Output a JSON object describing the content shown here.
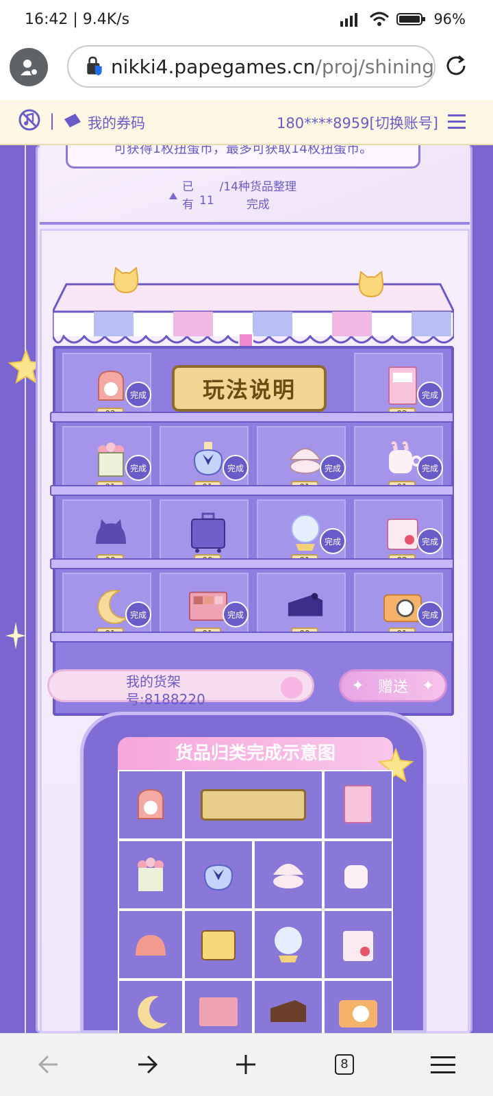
{
  "status": {
    "time_speed": "16:42 | 9.4K/s",
    "battery": "96%"
  },
  "browser": {
    "url_domain": "nikki4.papegames.cn",
    "url_path": "/proj/shining",
    "tab_count": "8"
  },
  "site_header": {
    "separator": "|",
    "coupon_label": "我的券码",
    "account": "180****8959[切换账号]"
  },
  "top_panel": {
    "tip_text": "可获得1枚扭蛋币，最多可获取14枚扭蛋币。",
    "progress_prefix_1": "已",
    "progress_prefix_2": "有",
    "progress_count": "11",
    "progress_suffix_1": "/14种货品整理",
    "progress_suffix_2": "完成"
  },
  "shelf": {
    "instructions_sign": "玩法说明",
    "done_label": "完成",
    "items": [
      {
        "icon": "backpack-icon",
        "count": "02",
        "done": true
      },
      {
        "icon": "photo-album-icon",
        "count": "02",
        "done": true
      },
      {
        "icon": "flower-basket-icon",
        "count": "01",
        "done": true
      },
      {
        "icon": "perfume-bottle-icon",
        "count": "01",
        "done": true
      },
      {
        "icon": "shell-icon",
        "count": "01",
        "done": true
      },
      {
        "icon": "bunny-mug-icon",
        "count": "01",
        "done": true
      },
      {
        "icon": "cat-hat-icon",
        "count": "00",
        "done": false
      },
      {
        "icon": "suitcase-icon",
        "count": "00",
        "done": false
      },
      {
        "icon": "crystal-ball-icon",
        "count": "01",
        "done": true
      },
      {
        "icon": "milk-carton-icon",
        "count": "02",
        "done": true
      },
      {
        "icon": "moon-pillow-icon",
        "count": "01",
        "done": true
      },
      {
        "icon": "makeup-palette-icon",
        "count": "01",
        "done": true
      },
      {
        "icon": "cake-icon",
        "count": "00",
        "done": false
      },
      {
        "icon": "camera-icon",
        "count": "01",
        "done": true
      }
    ]
  },
  "my_shelf": {
    "label_line1": "我的货架",
    "label_line2": "号:8188220"
  },
  "gift_button": "赠送",
  "demo": {
    "title": "货品归类完成示意图"
  },
  "colors": {
    "accent": "#6a5cc8",
    "background": "#7b66cf"
  }
}
